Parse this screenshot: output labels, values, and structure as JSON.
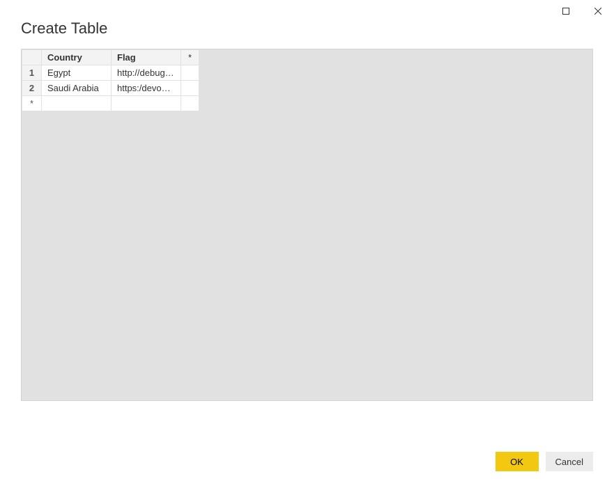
{
  "window": {
    "title": "Create Table"
  },
  "table": {
    "columns": {
      "country": "Country",
      "flag": "Flag",
      "star": "*"
    },
    "rows": [
      {
        "num": "1",
        "country": "Egypt",
        "flag": "http://debug.to/"
      },
      {
        "num": "2",
        "country": "Saudi Arabia",
        "flag": "https:/devowor..."
      }
    ],
    "new_row_marker": "*"
  },
  "buttons": {
    "ok": "OK",
    "cancel": "Cancel"
  }
}
